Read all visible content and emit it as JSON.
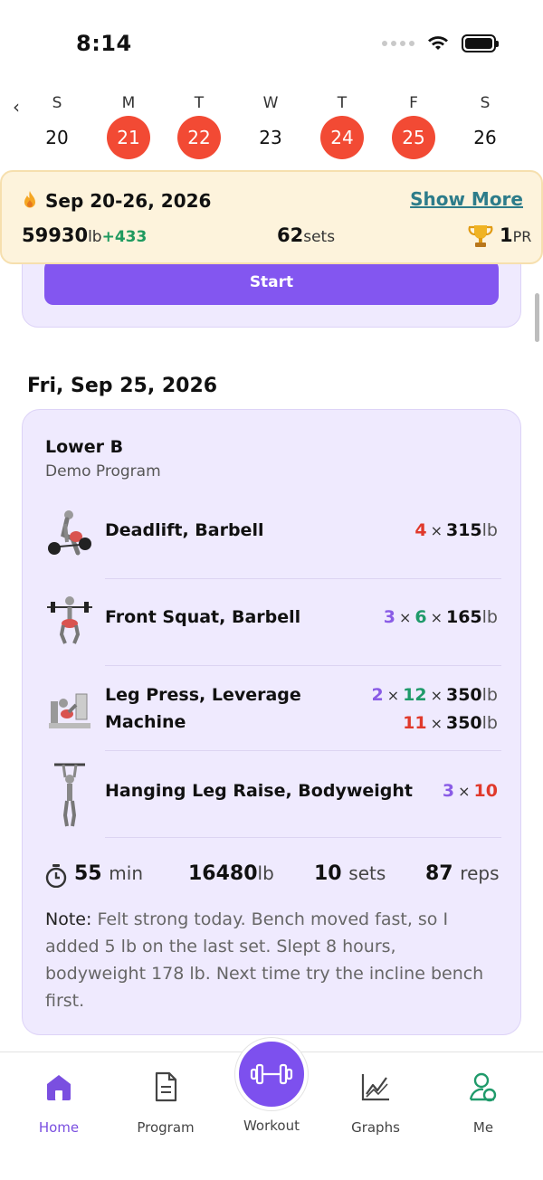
{
  "status_bar": {
    "time": "8:14"
  },
  "week": {
    "prev_icon": "chevron-left-icon",
    "days": [
      {
        "letter": "S",
        "num": "20",
        "active": false
      },
      {
        "letter": "M",
        "num": "21",
        "active": true
      },
      {
        "letter": "T",
        "num": "22",
        "active": true
      },
      {
        "letter": "W",
        "num": "23",
        "active": false
      },
      {
        "letter": "T",
        "num": "24",
        "active": true
      },
      {
        "letter": "F",
        "num": "25",
        "active": true
      },
      {
        "letter": "S",
        "num": "26",
        "active": false
      }
    ],
    "active_color": "#f24a34"
  },
  "summary": {
    "range": "Sep 20-26, 2026",
    "show_more": "Show More",
    "weight": "59930",
    "weight_unit": "lb",
    "weight_delta": "+433",
    "sets": "62",
    "sets_unit": "sets",
    "pr": "1",
    "pr_unit": "PR"
  },
  "prev_card": {
    "start_label": "Start"
  },
  "day_heading": "Fri, Sep 25, 2026",
  "workout": {
    "title": "Lower B",
    "program": "Demo Program",
    "exercises": [
      {
        "name_line1": "Deadlift, Barbell",
        "sets": "4",
        "weight": "315",
        "unit": "lb"
      },
      {
        "name_line1": "Front Squat, Barbell",
        "sets": "3",
        "reps": "6",
        "weight": "165",
        "unit": "lb"
      },
      {
        "name_line1": "Leg Press, Leverage",
        "name_line2": "Machine",
        "sets": "2",
        "reps": "12",
        "weight": "350",
        "unit": "lb",
        "sets2": "11",
        "weight2": "350",
        "unit2": "lb"
      },
      {
        "name_line1": "Hanging Leg Raise, Bodyweight",
        "sets": "3",
        "reps": "10"
      }
    ],
    "stats": {
      "duration": "55",
      "duration_unit": "min",
      "volume": "16480",
      "volume_unit": "lb",
      "sets": "10",
      "sets_unit": "sets",
      "reps": "87",
      "reps_unit": "reps"
    },
    "note_label": "Note:",
    "note_text": "Felt strong today. Bench moved fast, so I added 5 lb on the last set. Slept 8 hours, bodyweight 178 lb. Next time try the incline bench first."
  },
  "tabs": {
    "home": "Home",
    "program": "Program",
    "workout": "Workout",
    "graphs": "Graphs",
    "me": "Me"
  },
  "colors": {
    "accent": "#7d50ee",
    "active_tab": "#7a4fe0",
    "card_bg": "#efeafe"
  }
}
